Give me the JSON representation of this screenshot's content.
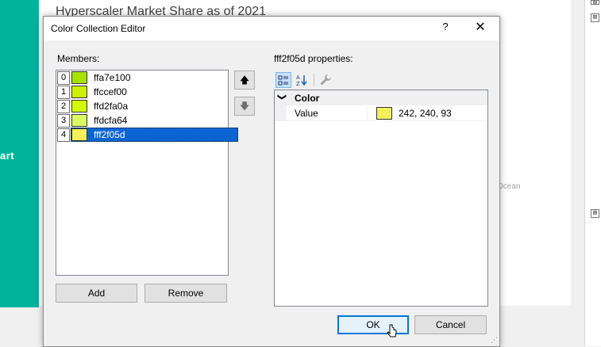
{
  "background": {
    "chart_title": "Hyperscaler Market Share as of 2021",
    "teal_text": "art",
    "map_label": "Ocean",
    "tree_expanders": [
      "⊞",
      "⊞",
      "⊞"
    ]
  },
  "dialog": {
    "title": "Color Collection Editor",
    "help_label": "?",
    "close_label": "✕",
    "members_label": "Members:",
    "members": [
      {
        "index": "0",
        "name": "ffa7e100",
        "color": "#a7e100"
      },
      {
        "index": "1",
        "name": "ffccef00",
        "color": "#ccef00"
      },
      {
        "index": "2",
        "name": "ffd2fa0a",
        "color": "#d2fa0a"
      },
      {
        "index": "3",
        "name": "ffdcfa64",
        "color": "#dcfa64"
      },
      {
        "index": "4",
        "name": "fff2f05d",
        "color": "#f2f05d"
      }
    ],
    "move_up_label": "🡅",
    "move_down_label": "🡇",
    "add_label": "Add",
    "remove_label": "Remove",
    "properties_label": "fff2f05d properties:",
    "property_grid": {
      "category": "Color",
      "category_chevron": "❯",
      "property_name": "Value",
      "property_value": "242, 240, 93",
      "property_color": "#f2f05d"
    },
    "ok_label": "OK",
    "cancel_label": "Cancel"
  },
  "colors": {
    "teal": "#00b39b",
    "selection": "#0a64d2"
  }
}
